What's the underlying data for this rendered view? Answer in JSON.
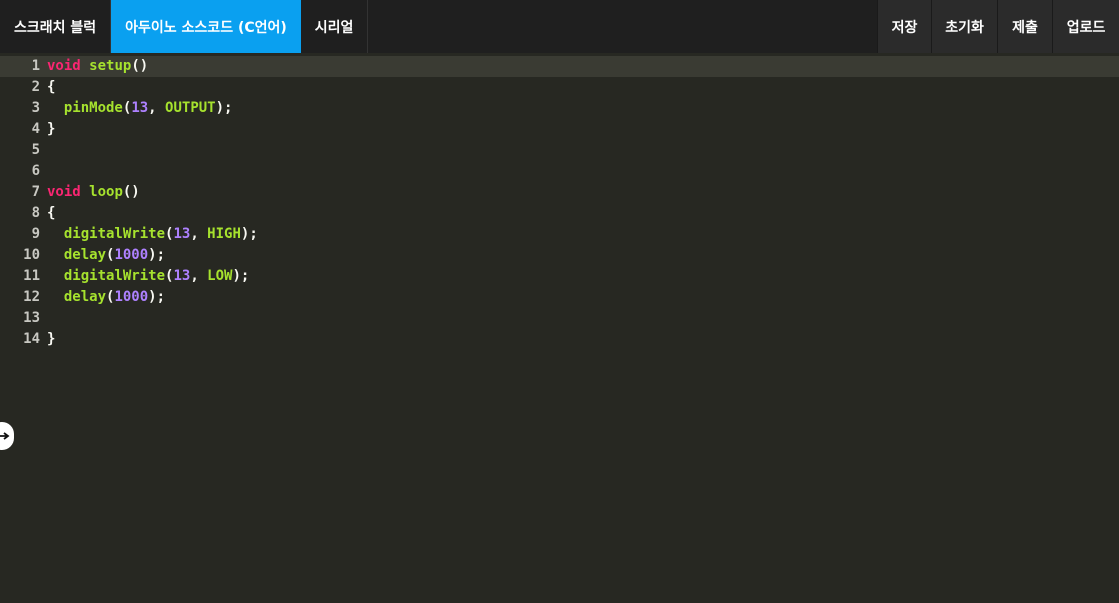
{
  "tabs": [
    {
      "label": "스크래치 블럭",
      "active": false
    },
    {
      "label": "아두이노 소스코드 (C언어)",
      "active": true
    },
    {
      "label": "시리얼",
      "active": false
    }
  ],
  "actions": {
    "save": "저장",
    "reset": "초기화",
    "submit": "제출",
    "upload": "업로드"
  },
  "colors": {
    "accent": "#0aa0f0",
    "keyword": "#f92672",
    "function": "#a6e22e",
    "number": "#ae81ff",
    "background": "#272822"
  },
  "editor": {
    "current_line": 1,
    "lines": [
      {
        "n": "1",
        "tokens": [
          [
            "kw",
            "void"
          ],
          [
            "pl",
            " "
          ],
          [
            "fn",
            "setup"
          ],
          [
            "pl",
            "()"
          ]
        ]
      },
      {
        "n": "2",
        "tokens": [
          [
            "pl",
            "{"
          ]
        ]
      },
      {
        "n": "3",
        "tokens": [
          [
            "pl",
            "  "
          ],
          [
            "fn",
            "pinMode"
          ],
          [
            "pl",
            "("
          ],
          [
            "num",
            "13"
          ],
          [
            "pl",
            ", "
          ],
          [
            "fn",
            "OUTPUT"
          ],
          [
            "pl",
            ");"
          ]
        ]
      },
      {
        "n": "4",
        "tokens": [
          [
            "pl",
            "}"
          ]
        ]
      },
      {
        "n": "5",
        "tokens": []
      },
      {
        "n": "6",
        "tokens": []
      },
      {
        "n": "7",
        "tokens": [
          [
            "kw",
            "void"
          ],
          [
            "pl",
            " "
          ],
          [
            "fn",
            "loop"
          ],
          [
            "pl",
            "()"
          ]
        ]
      },
      {
        "n": "8",
        "tokens": [
          [
            "pl",
            "{"
          ]
        ]
      },
      {
        "n": "9",
        "tokens": [
          [
            "pl",
            "  "
          ],
          [
            "fn",
            "digitalWrite"
          ],
          [
            "pl",
            "("
          ],
          [
            "num",
            "13"
          ],
          [
            "pl",
            ", "
          ],
          [
            "fn",
            "HIGH"
          ],
          [
            "pl",
            ");"
          ]
        ]
      },
      {
        "n": "10",
        "tokens": [
          [
            "pl",
            "  "
          ],
          [
            "fn",
            "delay"
          ],
          [
            "pl",
            "("
          ],
          [
            "num",
            "1000"
          ],
          [
            "pl",
            ");"
          ]
        ]
      },
      {
        "n": "11",
        "tokens": [
          [
            "pl",
            "  "
          ],
          [
            "fn",
            "digitalWrite"
          ],
          [
            "pl",
            "("
          ],
          [
            "num",
            "13"
          ],
          [
            "pl",
            ", "
          ],
          [
            "fn",
            "LOW"
          ],
          [
            "pl",
            ");"
          ]
        ]
      },
      {
        "n": "12",
        "tokens": [
          [
            "pl",
            "  "
          ],
          [
            "fn",
            "delay"
          ],
          [
            "pl",
            "("
          ],
          [
            "num",
            "1000"
          ],
          [
            "pl",
            ");"
          ]
        ]
      },
      {
        "n": "13",
        "tokens": []
      },
      {
        "n": "14",
        "tokens": [
          [
            "pl",
            "}"
          ]
        ]
      }
    ]
  },
  "panel_toggle_icon": "arrow-right-icon"
}
